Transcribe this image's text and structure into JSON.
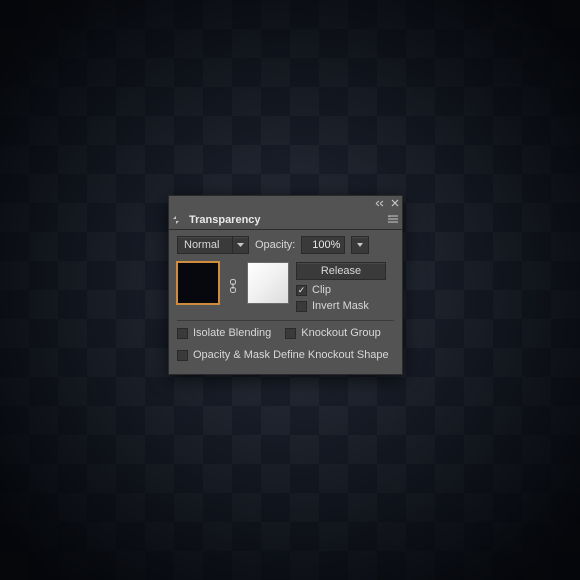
{
  "panel": {
    "title": "Transparency",
    "blend_mode": "Normal",
    "opacity_label": "Opacity:",
    "opacity_value": "100%",
    "release_btn": "Release",
    "clip_label": "Clip",
    "clip_checked": true,
    "invert_mask_label": "Invert Mask",
    "invert_mask_checked": false,
    "isolate_label": "Isolate Blending",
    "isolate_checked": false,
    "knockout_label": "Knockout Group",
    "knockout_checked": false,
    "opacity_mask_define_label": "Opacity & Mask Define Knockout Shape",
    "opacity_mask_define_checked": false
  }
}
